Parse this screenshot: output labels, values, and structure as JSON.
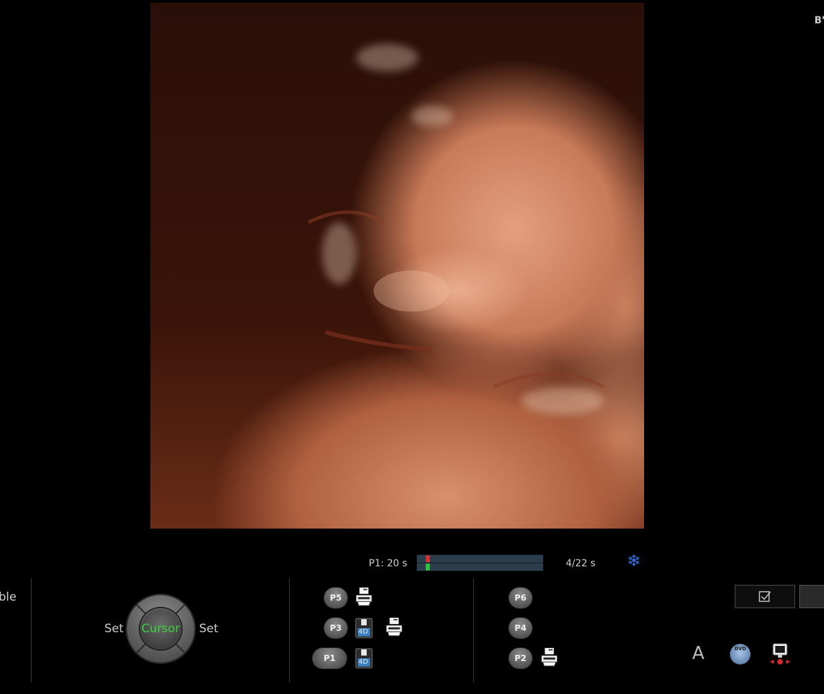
{
  "corner_text": "B’",
  "cine": {
    "label": "P1:  20 s",
    "frames": "4/22 s",
    "freeze_icon": "snowflake-icon",
    "position_fraction": 0.04,
    "colors": {
      "marker_top": "#d23232",
      "marker_bottom": "#2fbf3a",
      "freeze": "#3b6fe0"
    }
  },
  "left_panel": {
    "truncated_label": "ble"
  },
  "trackball": {
    "set_left": "Set",
    "center_label": "Cursor",
    "set_right": "Set",
    "center_color": "#39d13c"
  },
  "presets_left": {
    "p5": "P5",
    "p3": "P3",
    "p1": "P1",
    "disk_label": "4D"
  },
  "presets_right": {
    "p6": "P6",
    "p4": "P4",
    "p2": "P2"
  },
  "right_tools": {
    "check_icon": "checkbox-icon",
    "annotate_label": "A",
    "dvd_label": "DVD",
    "monitor_icon": "monitor-icon"
  }
}
